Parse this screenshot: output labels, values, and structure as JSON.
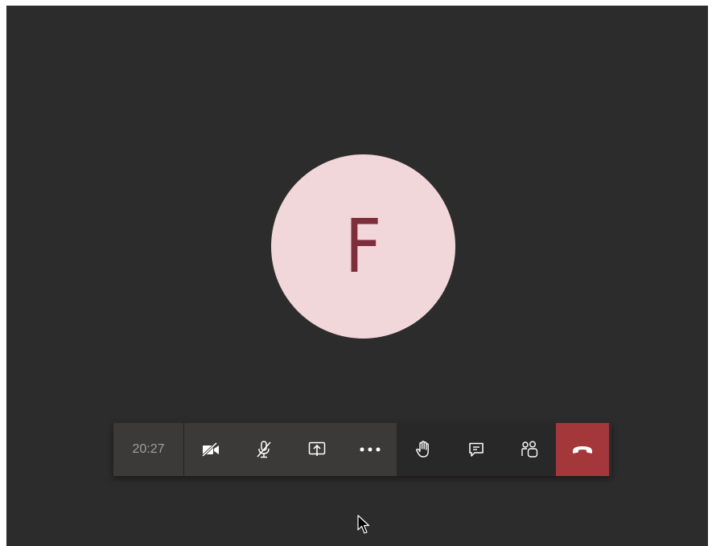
{
  "avatar": {
    "initial": "F",
    "background": "#f2d7da",
    "letter_color": "#7e2e3a"
  },
  "call": {
    "duration": "20:27"
  },
  "controls": {
    "camera": {
      "icon": "video-off-icon"
    },
    "mic": {
      "icon": "mic-off-icon"
    },
    "share": {
      "icon": "share-screen-icon"
    },
    "more": {
      "icon": "more-icon"
    },
    "raise_hand": {
      "icon": "raise-hand-icon"
    },
    "chat": {
      "icon": "chat-icon"
    },
    "participants": {
      "icon": "participants-icon"
    },
    "hang_up": {
      "icon": "hang-up-icon",
      "color": "#a4373a"
    }
  },
  "colors": {
    "stage_background": "#2d2c2c",
    "toolbar_light": "#3b3a39",
    "toolbar_dark": "#292828"
  }
}
